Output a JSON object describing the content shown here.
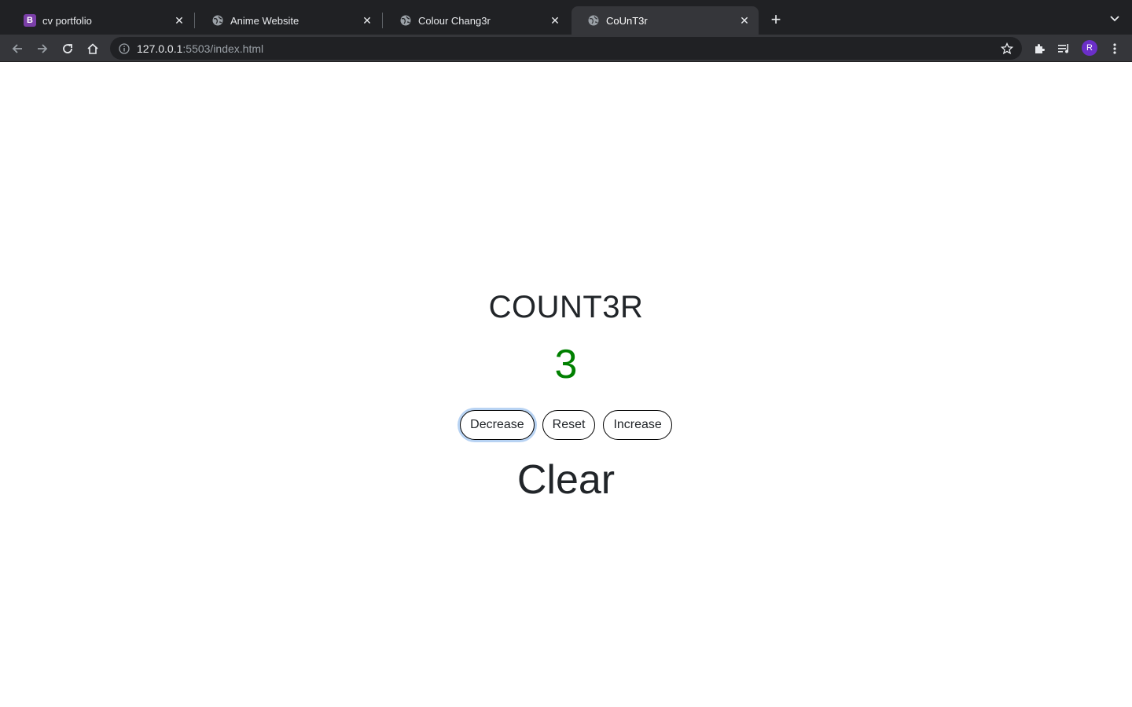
{
  "browser": {
    "tabs": [
      {
        "title": "cv portfolio",
        "favicon": "bootstrap-icon",
        "active": false
      },
      {
        "title": "Anime Website",
        "favicon": "globe-icon",
        "active": false
      },
      {
        "title": "Colour Chang3r",
        "favicon": "globe-icon",
        "active": false
      },
      {
        "title": "CoUnT3r",
        "favicon": "globe-icon",
        "active": true
      }
    ],
    "new_tab_symbol": "+",
    "tab_close_symbol": "✕",
    "url_host": "127.0.0.1",
    "url_rest": ":5503/index.html",
    "profile_initial": "R",
    "bootstrap_letter": "B"
  },
  "page": {
    "heading": "COUNT3R",
    "count": "3",
    "count_color": "#008000",
    "buttons": {
      "decrease": "Decrease",
      "reset": "Reset",
      "increase": "Increase"
    },
    "clear_label": "Clear"
  }
}
